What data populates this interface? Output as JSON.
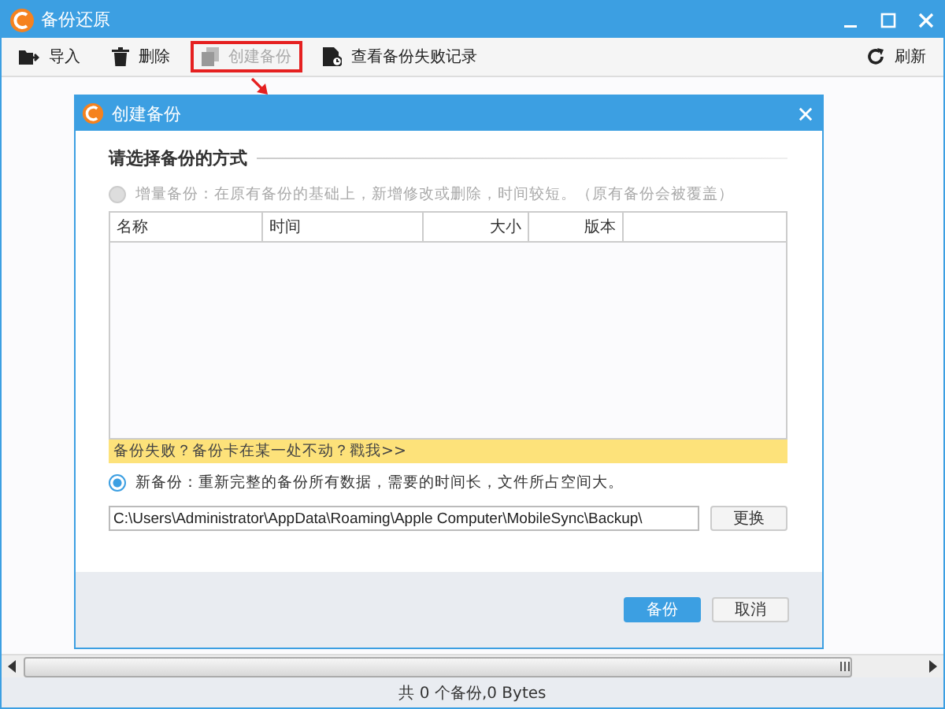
{
  "window": {
    "title": "备份还原"
  },
  "toolbar": {
    "items": [
      {
        "label": "导入",
        "disabled": false,
        "highlighted": false
      },
      {
        "label": "删除",
        "disabled": false,
        "highlighted": false
      },
      {
        "label": "创建备份",
        "disabled": true,
        "highlighted": true
      },
      {
        "label": "查看备份失败记录",
        "disabled": false,
        "highlighted": false
      }
    ],
    "refresh": "刷新"
  },
  "dialog": {
    "title": "创建备份",
    "section_title": "请选择备份的方式",
    "options": [
      {
        "label": "增量备份：在原有备份的基础上，新增修改或删除，时间较短。（原有备份会被覆盖）",
        "selected": false,
        "disabled": true
      },
      {
        "label": "新备份：重新完整的备份所有数据，需要的时间长，文件所占空间大。",
        "selected": true,
        "disabled": false
      }
    ],
    "table": {
      "columns": [
        {
          "label": "名称"
        },
        {
          "label": "时间"
        },
        {
          "label": "大小"
        },
        {
          "label": "版本"
        }
      ]
    },
    "notice": "备份失败？备份卡在某一处不动？戳我>>",
    "path": "C:\\Users\\Administrator\\AppData\\Roaming\\Apple Computer\\MobileSync\\Backup\\",
    "change_button": "更换",
    "buttons": [
      {
        "label": "备份",
        "primary": true
      },
      {
        "label": "取消",
        "primary": false
      }
    ]
  },
  "status_bar": "共 0 个备份,0 Bytes"
}
